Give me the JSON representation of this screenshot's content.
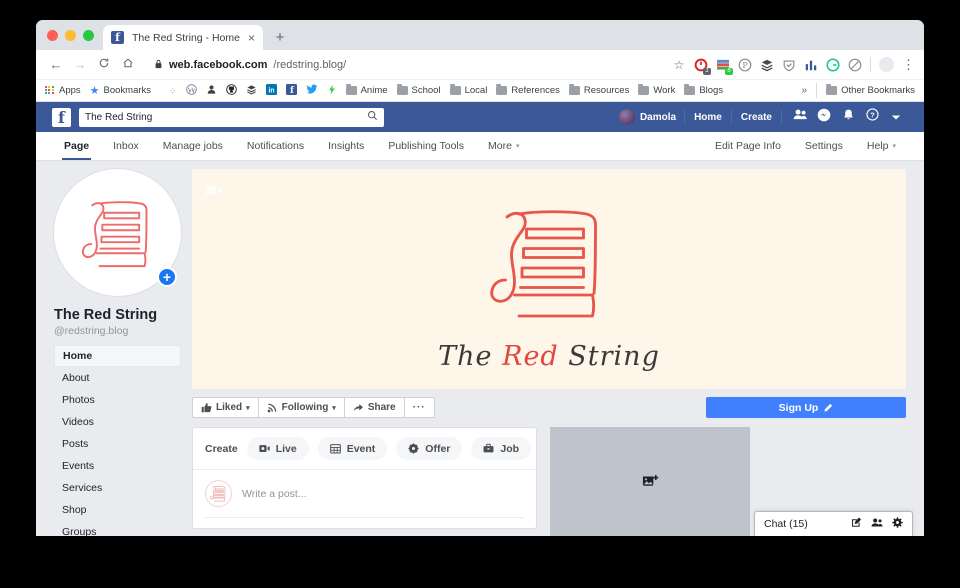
{
  "browser": {
    "tab": {
      "title": "The Red String - Home",
      "favicon_letter": "f",
      "close_icon": "×",
      "newtab_icon": "+"
    },
    "nav": {
      "back_icon": "←",
      "forward_icon": "→",
      "reload_icon": "C",
      "home_icon": "⌂"
    },
    "omnibox": {
      "lock_icon": "🔒",
      "host": "web.facebook.com",
      "path": "/redstring.blog/"
    },
    "extensions": [
      {
        "name": "bookmark-star-icon",
        "glyph": "☆",
        "color": "#5f6368",
        "badge": ""
      },
      {
        "name": "clock-extension-icon",
        "glyph": "C",
        "color": "#e02020",
        "badge": "1",
        "badge_color": "#5f6368"
      },
      {
        "name": "color-stack-extension-icon",
        "glyph": "▤",
        "color": "#4a90d9",
        "badge": "6",
        "badge_color": "#2ecc40"
      },
      {
        "name": "pinterest-icon",
        "glyph": "P",
        "color": "#7a7a7a",
        "badge": ""
      },
      {
        "name": "layers-icon",
        "glyph": "≋",
        "color": "#4a4a4a",
        "badge": ""
      },
      {
        "name": "shield-icon",
        "glyph": "⛊",
        "color": "#7a7a7a",
        "badge": ""
      },
      {
        "name": "analytics-icon",
        "glyph": "▮",
        "color": "#3b5998",
        "badge": ""
      },
      {
        "name": "grammar-extension-icon",
        "glyph": "G",
        "color": "#15c39a",
        "badge": ""
      },
      {
        "name": "block-circle-icon",
        "glyph": "⊘",
        "color": "#7a7a7a",
        "badge": ""
      }
    ],
    "profile_icon": "avatar",
    "menu_icon": "⋮",
    "bookmarks": [
      {
        "label": "Apps",
        "icon": "apps-grid-icon"
      },
      {
        "label": "Bookmarks",
        "icon": "star-icon"
      },
      {
        "label": "",
        "icon": "apple-icon"
      },
      {
        "label": "",
        "icon": "dots-icon"
      },
      {
        "label": "",
        "icon": "wordpress-icon"
      },
      {
        "label": "",
        "icon": "person-icon"
      },
      {
        "label": "",
        "icon": "github-icon"
      },
      {
        "label": "",
        "icon": "stack-icon"
      },
      {
        "label": "",
        "icon": "linkedin-icon"
      },
      {
        "label": "",
        "icon": "facebook-icon"
      },
      {
        "label": "",
        "icon": "twitter-icon"
      },
      {
        "label": "",
        "icon": "lightning-icon"
      },
      {
        "label": "Anime",
        "icon": "folder-icon"
      },
      {
        "label": "School",
        "icon": "folder-icon"
      },
      {
        "label": "Local",
        "icon": "folder-icon"
      },
      {
        "label": "References",
        "icon": "folder-icon"
      },
      {
        "label": "Resources",
        "icon": "folder-icon"
      },
      {
        "label": "Work",
        "icon": "folder-icon"
      },
      {
        "label": "Blogs",
        "icon": "folder-icon"
      }
    ],
    "bookmarks_overflow": "»",
    "other_bookmarks": "Other Bookmarks"
  },
  "facebook": {
    "logo_letter": "f",
    "search": {
      "value": "The Red String",
      "placeholder": "Search",
      "icon": "search-icon"
    },
    "topbar": {
      "user_name": "Damola",
      "home_label": "Home",
      "create_label": "Create",
      "icons": [
        {
          "name": "friend-requests-icon",
          "glyph": "friends"
        },
        {
          "name": "messenger-icon",
          "glyph": "messenger"
        },
        {
          "name": "notifications-bell-icon",
          "glyph": "bell"
        },
        {
          "name": "help-icon",
          "glyph": "question"
        },
        {
          "name": "account-menu-caret-icon",
          "glyph": "caret"
        }
      ]
    },
    "page_tabs": [
      {
        "label": "Page",
        "active": true
      },
      {
        "label": "Inbox",
        "active": false
      },
      {
        "label": "Manage jobs",
        "active": false
      },
      {
        "label": "Notifications",
        "active": false
      },
      {
        "label": "Insights",
        "active": false
      },
      {
        "label": "Publishing Tools",
        "active": false
      },
      {
        "label": "More",
        "active": false,
        "caret": true
      }
    ],
    "page_tabs_right": [
      {
        "label": "Edit Page Info",
        "caret": false
      },
      {
        "label": "Settings",
        "caret": false
      },
      {
        "label": "Help",
        "caret": true
      }
    ],
    "profile": {
      "name": "The Red String",
      "handle": "@redstring.blog",
      "add_photo_icon": "+"
    },
    "sidebar": [
      {
        "label": "Home",
        "active": true
      },
      {
        "label": "About",
        "active": false
      },
      {
        "label": "Photos",
        "active": false
      },
      {
        "label": "Videos",
        "active": false
      },
      {
        "label": "Posts",
        "active": false
      },
      {
        "label": "Events",
        "active": false
      },
      {
        "label": "Services",
        "active": false
      },
      {
        "label": "Shop",
        "active": false
      },
      {
        "label": "Groups",
        "active": false
      }
    ],
    "cover": {
      "camera_icon": "video-camera-icon",
      "word1": "The ",
      "word2": "Red ",
      "word3": "String",
      "bg_color": "#fdf6e9",
      "logo_color": "#e8554a"
    },
    "actions": [
      {
        "label": "Liked",
        "icon": "thumbs-up-icon",
        "caret": true
      },
      {
        "label": "Following",
        "icon": "rss-icon",
        "caret": true
      },
      {
        "label": "Share",
        "icon": "share-arrow-icon",
        "caret": false
      },
      {
        "label": "",
        "icon": "ellipsis-icon",
        "caret": false
      }
    ],
    "signup": {
      "label": "Sign Up",
      "icon": "pencil-icon",
      "color": "#4080ff"
    },
    "create": {
      "label": "Create",
      "items": [
        {
          "label": "Live",
          "icon": "camera-icon"
        },
        {
          "label": "Event",
          "icon": "calendar-icon"
        },
        {
          "label": "Offer",
          "icon": "tag-icon"
        },
        {
          "label": "Job",
          "icon": "briefcase-icon"
        }
      ]
    },
    "composer": {
      "placeholder": "Write a post...",
      "avatar": "page-avatar"
    },
    "media_placeholder": {
      "icon": "add-image-icon"
    },
    "chat": {
      "label": "Chat (15)",
      "icons": [
        {
          "name": "compose-message-icon",
          "glyph": "compose"
        },
        {
          "name": "group-chat-icon",
          "glyph": "group"
        },
        {
          "name": "chat-settings-gear-icon",
          "glyph": "gear"
        }
      ]
    }
  }
}
